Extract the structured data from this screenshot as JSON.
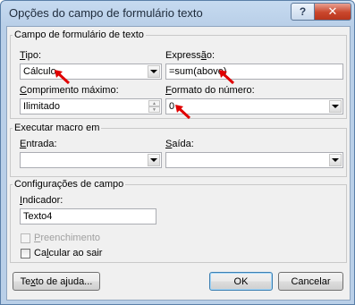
{
  "window": {
    "title": "Opções do campo de formulário texto",
    "help_label": "?",
    "close_label": "✕"
  },
  "campo_group": {
    "title": "Campo de formulário de texto",
    "tipo": {
      "label_u": "T",
      "label_rest": "ipo:",
      "value": "Cálculo"
    },
    "expressao": {
      "label_pre": "Express",
      "label_u": "ã",
      "label_post": "o:",
      "value": "=sum(above)"
    },
    "comprimento": {
      "label_u": "C",
      "label_rest": "omprimento máximo:",
      "value": "Ilimitado"
    },
    "formato": {
      "label_u": "F",
      "label_rest": "ormato do número:",
      "value": "0"
    }
  },
  "macro_group": {
    "title": "Executar macro em",
    "entrada": {
      "label_u": "E",
      "label_rest": "ntrada:",
      "value": ""
    },
    "saida": {
      "label_u": "S",
      "label_rest": "aída:",
      "value": ""
    }
  },
  "config_group": {
    "title": "Configurações de campo",
    "indicador": {
      "label_u": "I",
      "label_rest": "ndicador:",
      "value": "Texto4"
    },
    "preenchimento": {
      "label_u": "P",
      "label_rest": "reenchimento",
      "checked": false,
      "enabled": false
    },
    "calcular": {
      "label_pre": "Ca",
      "label_u": "l",
      "label_post": "cular ao sair",
      "checked": false
    }
  },
  "buttons": {
    "help": {
      "pre": "Te",
      "u": "x",
      "post": "to de ajuda..."
    },
    "ok": "OK",
    "cancel": "Cancelar"
  },
  "colors": {
    "annotation_arrow": "#e00000",
    "accent": "#3c7fb1"
  }
}
